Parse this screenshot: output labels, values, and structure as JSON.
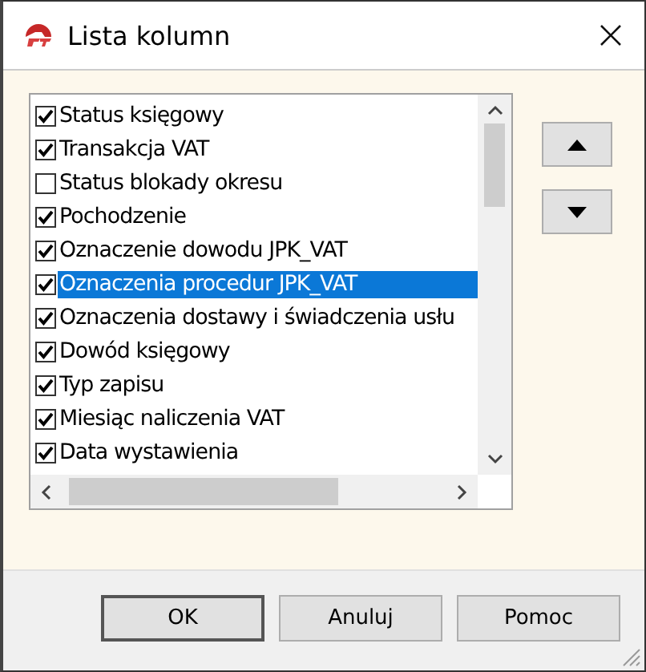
{
  "window": {
    "title": "Lista kolumn"
  },
  "list": {
    "items": [
      {
        "label": "Status księgowy",
        "checked": true,
        "selected": false
      },
      {
        "label": "Transakcja VAT",
        "checked": true,
        "selected": false
      },
      {
        "label": "Status blokady okresu",
        "checked": false,
        "selected": false
      },
      {
        "label": "Pochodzenie",
        "checked": true,
        "selected": false
      },
      {
        "label": "Oznaczenie dowodu JPK_VAT",
        "checked": true,
        "selected": false
      },
      {
        "label": "Oznaczenia procedur JPK_VAT",
        "checked": true,
        "selected": true
      },
      {
        "label": "Oznaczenia dostawy i świadczenia usłu",
        "checked": true,
        "selected": false
      },
      {
        "label": "Dowód księgowy",
        "checked": true,
        "selected": false
      },
      {
        "label": "Typ zapisu",
        "checked": true,
        "selected": false
      },
      {
        "label": "Miesiąc naliczenia VAT",
        "checked": true,
        "selected": false
      },
      {
        "label": "Data wystawienia",
        "checked": true,
        "selected": false
      }
    ]
  },
  "buttons": [
    "OK",
    "Anuluj",
    "Pomoc"
  ]
}
